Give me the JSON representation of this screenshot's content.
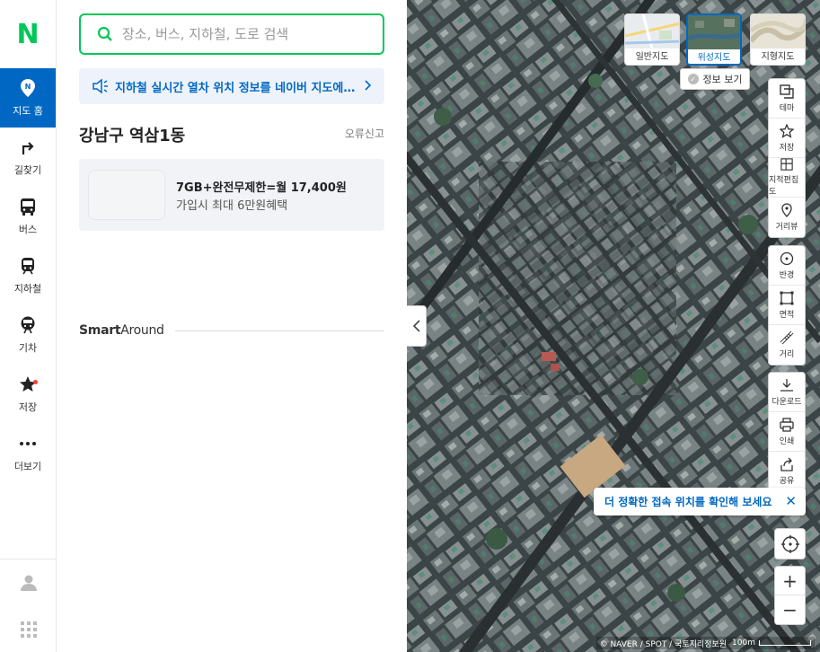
{
  "nav": {
    "logo": "N",
    "items": [
      {
        "label": "지도 홈",
        "icon": "map-pin-icon",
        "active": true
      },
      {
        "label": "길찾기",
        "icon": "directions-arrow-icon"
      },
      {
        "label": "버스",
        "icon": "bus-icon"
      },
      {
        "label": "지하철",
        "icon": "subway-icon"
      },
      {
        "label": "기차",
        "icon": "train-icon"
      },
      {
        "label": "저장",
        "icon": "star-icon"
      },
      {
        "label": "더보기",
        "icon": "more-dots-icon"
      }
    ],
    "bottom": [
      {
        "icon": "user-icon"
      },
      {
        "icon": "apps-grid-icon"
      }
    ]
  },
  "search": {
    "placeholder": "장소, 버스, 지하철, 도로 검색"
  },
  "notice": {
    "text": "지하철 실시간 열차 위치 정보를 네이버 지도에서 확인하세요"
  },
  "region": {
    "title": "강남구 역삼1동",
    "report": "오류신고"
  },
  "ad": {
    "title": "7GB+완전무제한=월 17,400원",
    "subtitle": "가입시 최대 6만원혜택"
  },
  "smart_around": {
    "bold": "Smart",
    "rest": "Around"
  },
  "map": {
    "types": [
      {
        "label": "일반지도",
        "selected": false
      },
      {
        "label": "위성지도",
        "selected": true
      },
      {
        "label": "지형지도",
        "selected": false
      }
    ],
    "info_button": "정보 보기",
    "tools_group1": [
      {
        "label": "테마",
        "icon": "layers-icon"
      },
      {
        "label": "저장",
        "icon": "star-outline-icon"
      },
      {
        "label": "지적편집도",
        "icon": "cadastral-grid-icon"
      },
      {
        "label": "거리뷰",
        "icon": "street-view-pin-icon"
      }
    ],
    "tools_group2": [
      {
        "label": "반경",
        "icon": "radius-icon"
      },
      {
        "label": "면적",
        "icon": "area-icon"
      },
      {
        "label": "거리",
        "icon": "ruler-icon"
      }
    ],
    "tools_group3": [
      {
        "label": "다운로드",
        "icon": "download-icon"
      },
      {
        "label": "인쇄",
        "icon": "print-icon"
      },
      {
        "label": "공유",
        "icon": "share-icon"
      }
    ],
    "tip": "더 정확한 접속 위치를 확인해 보세요",
    "copyright": "© NAVER / SPOT / 국토지리정보원",
    "scale": "100m"
  },
  "colors": {
    "brand_green": "#03c75a",
    "accent_blue": "#0068c3"
  }
}
